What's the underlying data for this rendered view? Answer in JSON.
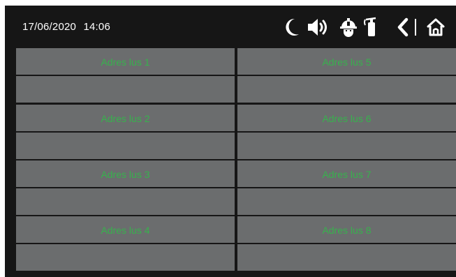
{
  "status": {
    "date": "17/06/2020",
    "time": "14:06"
  },
  "icons": [
    "moon-icon",
    "speaker-icon",
    "firefighter-helmet-icon",
    "fire-extinguisher-icon",
    "back-chevron-icon",
    "home-icon"
  ],
  "colors": {
    "background": "#161616",
    "cell": "#6b6d6e",
    "label": "#37b24d",
    "text": "#ffffff"
  },
  "addresses": {
    "left": [
      "Adres lus 1",
      "Adres lus 2",
      "Adres lus 3",
      "Adres lus 4"
    ],
    "right": [
      "Adres lus 5",
      "Adres lus 6",
      "Adres lus 7",
      "Adres lus 8"
    ]
  }
}
